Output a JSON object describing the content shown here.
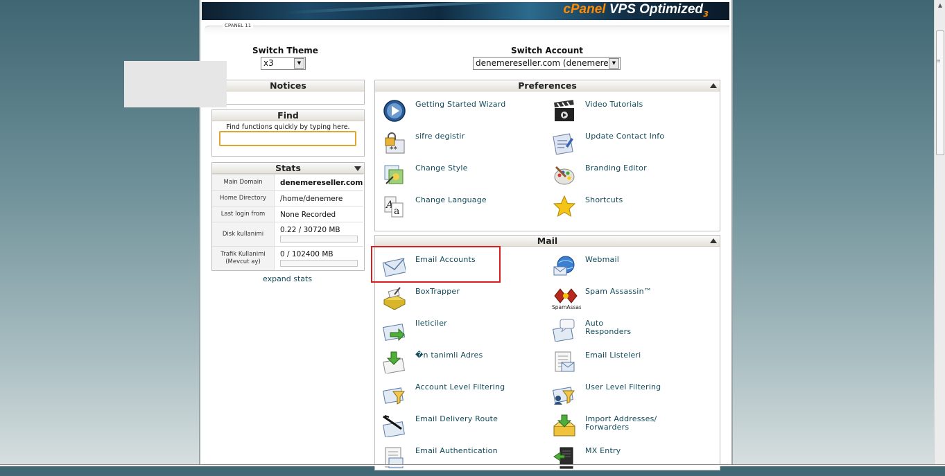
{
  "banner": {
    "logo_brand": "cPanel",
    "logo_product": "VPS Optimized",
    "logo_version": "3"
  },
  "section_label": "CPANEL 11",
  "switch_theme": {
    "title": "Switch Theme",
    "value": "x3"
  },
  "switch_account": {
    "title": "Switch Account",
    "value": "denemereseller.com (denemere)"
  },
  "notices": {
    "title": "Notices"
  },
  "find": {
    "title": "Find",
    "hint": "Find functions quickly by typing here.",
    "value": ""
  },
  "stats": {
    "title": "Stats",
    "rows": [
      {
        "label": "Main Domain",
        "value": "denemereseller.com"
      },
      {
        "label": "Home Directory",
        "value": "/home/denemere"
      },
      {
        "label": "Last login from",
        "value": "None Recorded"
      },
      {
        "label": "Disk kullanimi",
        "value": "0.22 / 30720 MB",
        "fraction": 0.0
      },
      {
        "label": "Trafik Kullanimi (Mevcut ay)",
        "value": "0 / 102400 MB",
        "fraction": 0.0
      }
    ],
    "expand_label": "expand stats"
  },
  "preferences": {
    "title": "Preferences",
    "items": [
      {
        "label": "Getting Started Wizard",
        "icon": "play-icon"
      },
      {
        "label": "Video Tutorials",
        "icon": "clapperboard-icon"
      },
      {
        "label": "sifre degistir",
        "icon": "lock-password-icon"
      },
      {
        "label": "Update Contact Info",
        "icon": "contact-card-icon"
      },
      {
        "label": "Change Style",
        "icon": "style-icon"
      },
      {
        "label": "Branding Editor",
        "icon": "palette-icon"
      },
      {
        "label": "Change Language",
        "icon": "language-icon"
      },
      {
        "label": "Shortcuts",
        "icon": "star-icon"
      }
    ]
  },
  "mail": {
    "title": "Mail",
    "items": [
      {
        "label": "Email Accounts",
        "icon": "envelope-icon"
      },
      {
        "label": "Webmail",
        "icon": "webmail-globe-icon"
      },
      {
        "label": "BoxTrapper",
        "icon": "boxtrapper-icon"
      },
      {
        "label": "Spam Assassin™",
        "icon": "spamassassin-icon",
        "icon_caption": "SpamAssassin"
      },
      {
        "label": "Ileticiler",
        "icon": "forwarders-icon"
      },
      {
        "label": "Auto",
        "label2": "Responders",
        "icon": "autoresponder-icon"
      },
      {
        "label": "�n tanimli Adres",
        "icon": "default-address-icon"
      },
      {
        "label": "Email Listeleri",
        "icon": "mailing-list-icon"
      },
      {
        "label": "Account Level Filtering",
        "icon": "account-filter-icon"
      },
      {
        "label": "User Level Filtering",
        "icon": "user-filter-icon"
      },
      {
        "label": "Email Delivery Route",
        "icon": "delivery-route-icon"
      },
      {
        "label": "Import Addresses/",
        "label2": "Forwarders",
        "icon": "import-icon"
      },
      {
        "label": "Email Authentication",
        "icon": "email-auth-icon"
      },
      {
        "label": "MX Entry",
        "icon": "mx-server-icon"
      }
    ]
  },
  "colors": {
    "link": "#124a5a",
    "highlight": "#d91c1c",
    "accent": "#ff8a00"
  }
}
